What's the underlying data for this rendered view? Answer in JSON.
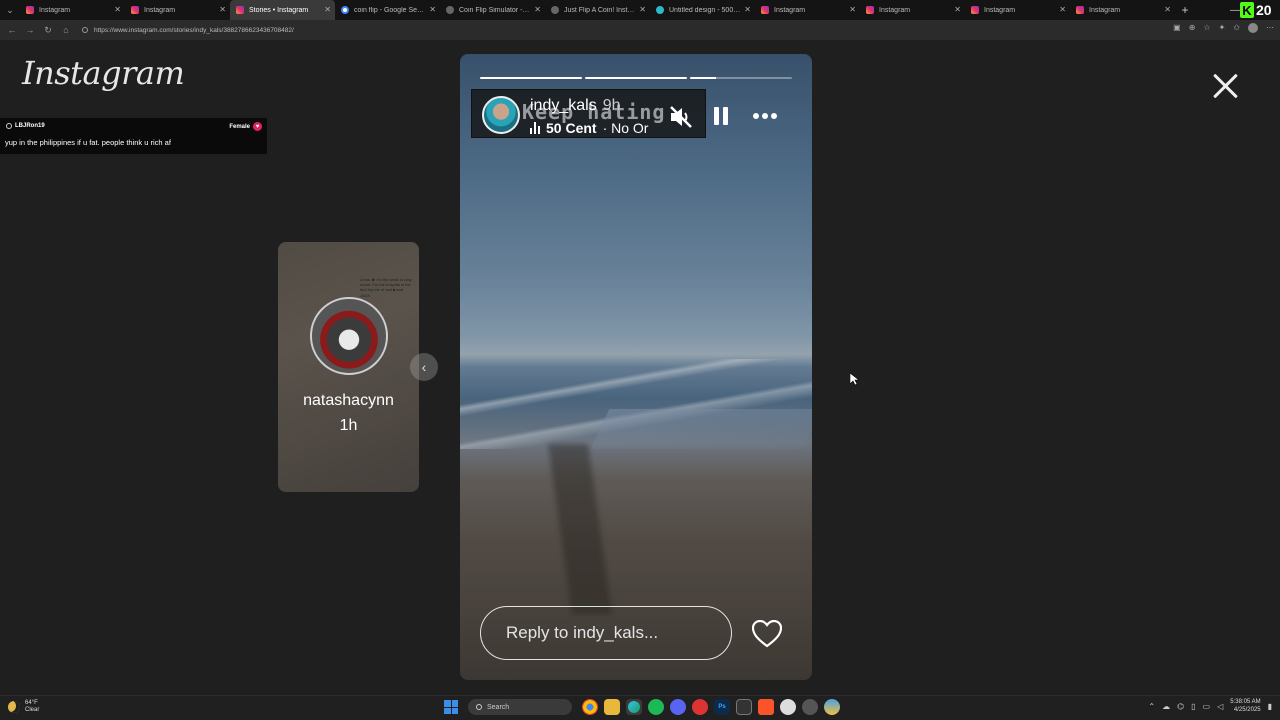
{
  "browser": {
    "tabs": [
      {
        "label": "Instagram",
        "favicon": "instagram-icon",
        "active": false
      },
      {
        "label": "Instagram",
        "favicon": "instagram-icon",
        "active": false
      },
      {
        "label": "Stories • Instagram",
        "favicon": "instagram-icon",
        "active": true
      },
      {
        "label": "coin flip - Google Search",
        "favicon": "google-icon",
        "active": false
      },
      {
        "label": "Coin Flip Simulator - Flip a C",
        "favicon": "globe-icon",
        "active": false
      },
      {
        "label": "Just Flip A Coin! Instant 50/5",
        "favicon": "globe-icon",
        "active": false
      },
      {
        "label": "Untitled design - 500 × 500p",
        "favicon": "canva-icon",
        "active": false
      },
      {
        "label": "Instagram",
        "favicon": "instagram-icon",
        "active": false
      },
      {
        "label": "Instagram",
        "favicon": "instagram-icon",
        "active": false
      },
      {
        "label": "Instagram",
        "favicon": "instagram-icon",
        "active": false
      },
      {
        "label": "Instagram",
        "favicon": "instagram-icon",
        "active": false
      }
    ],
    "url": "https://www.instagram.com/stories/indy_kals/3882786623436708482/",
    "kick_badge": {
      "letter": "K",
      "number": "20"
    }
  },
  "page": {
    "logo": "Instagram",
    "chat": {
      "username": "LBJRon19",
      "gender": "Female",
      "message": "yup in the philippines if u fat. people think u rich af"
    },
    "preview": {
      "username": "natashacynn",
      "time": "1h",
      "caption": "Lmao ☻ I'm the weak to play nurse. Put the hospital in the bed my me of sad ■ and JACK"
    },
    "story": {
      "username": "indy_kals",
      "time": "9h",
      "watermark": "Keep hating",
      "music_artist": "50 Cent",
      "music_title": "· No Or",
      "progress": [
        1,
        1,
        0.25
      ],
      "reply_placeholder": "Reply to indy_kals..."
    }
  },
  "taskbar": {
    "weather_temp": "64°F",
    "weather_desc": "Clear",
    "search_label": "Search",
    "time": "5:38:05 AM",
    "date": "4/25/2025"
  }
}
